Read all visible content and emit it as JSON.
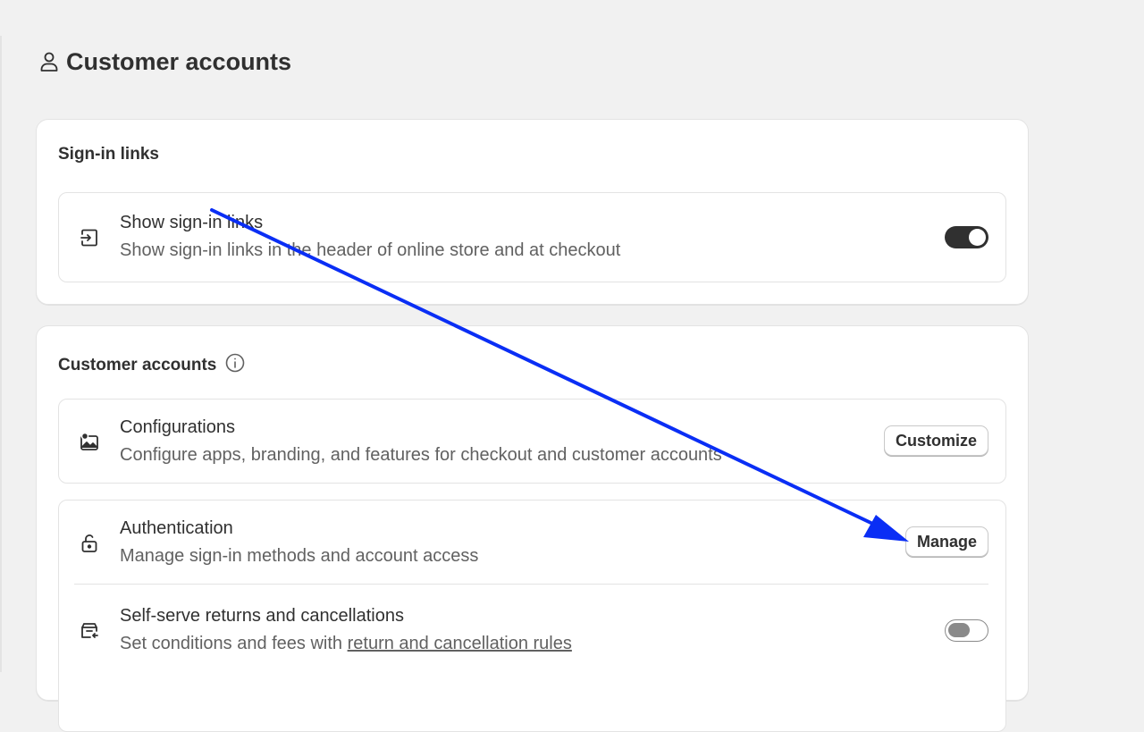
{
  "page": {
    "title": "Customer accounts",
    "title_icon": "person-icon"
  },
  "sign_in_links_card": {
    "heading": "Sign-in links",
    "row": {
      "icon": "enter-icon",
      "title": "Show sign-in links",
      "description": "Show sign-in links in the header of online store and at checkout",
      "toggle_on": true
    }
  },
  "customer_accounts_card": {
    "heading": "Customer accounts",
    "heading_icon": "info-icon",
    "configurations": {
      "icon": "image-icon",
      "title": "Configurations",
      "description": "Configure apps, branding, and features for checkout and customer accounts",
      "button": "Customize"
    },
    "authentication": {
      "icon": "unlock-icon",
      "title": "Authentication",
      "description": "Manage sign-in methods and account access",
      "button": "Manage"
    },
    "returns": {
      "icon": "return-box-icon",
      "title": "Self-serve returns and cancellations",
      "description_prefix": "Set conditions and fees with ",
      "description_link": "return and cancellation rules",
      "toggle_on": false
    }
  },
  "colors": {
    "annotation_arrow": "#0a2ef5",
    "toggle_on": "#303030",
    "toggle_off": "#8a8a8a"
  }
}
